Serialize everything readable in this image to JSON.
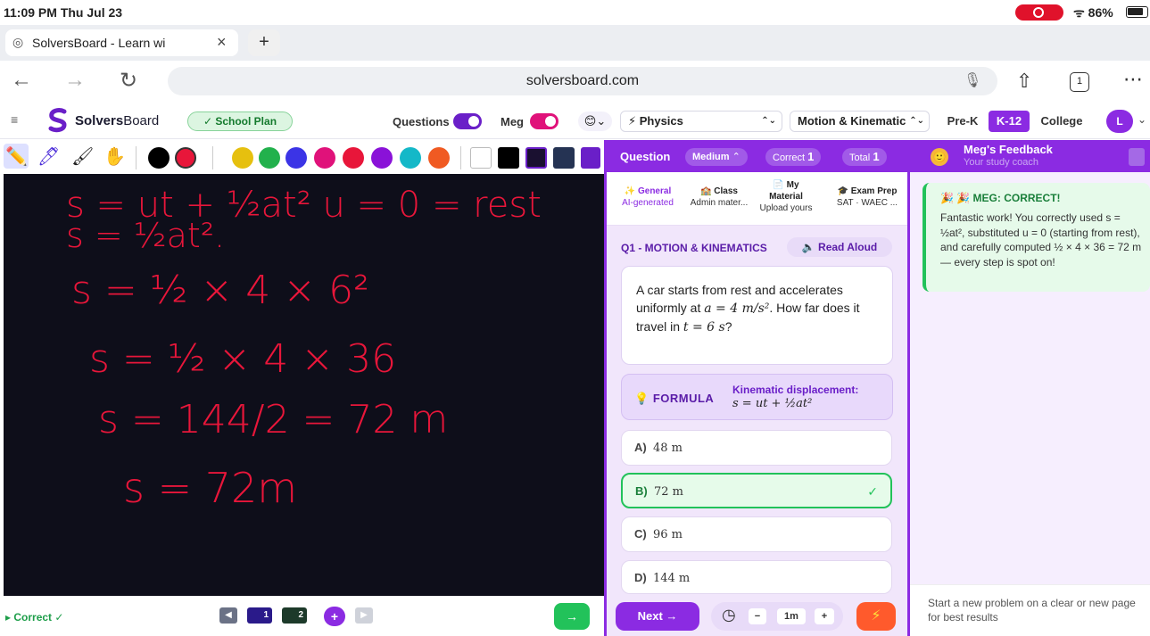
{
  "status": {
    "time": "11:09 PM  Thu Jul 23",
    "battery": "86%"
  },
  "browser": {
    "tab_title": "SolversBoard - Learn wi",
    "url": "solversboard.com",
    "tab_count": "1"
  },
  "header": {
    "brand_bold": "Solvers",
    "brand_light": "Board",
    "plan": "✓ School Plan",
    "questions_label": "Questions",
    "meg_label": "Meg",
    "subject": "⚡ Physics",
    "topic": "Motion & Kinematic",
    "levels": [
      "Pre-K",
      "K-12",
      "College"
    ],
    "avatar": "L"
  },
  "board": {
    "lines": [
      "s = ut + ½at²     u = 0 = rest",
      "s = ½at².",
      "s = ½ × 4 × 6²",
      "s = ½ × 4 × 36",
      "s = 144/2 = 72 m",
      "s = 72m"
    ],
    "status": "Correct ✓",
    "pages": [
      "1",
      "2"
    ]
  },
  "question": {
    "label": "Question",
    "difficulty": "Medium",
    "correct_label": "Correct",
    "correct_value": "1",
    "total_label": "Total",
    "total_value": "1",
    "sources": [
      {
        "title": "General",
        "sub": "AI-generated"
      },
      {
        "title": "Class",
        "sub": "Admin mater..."
      },
      {
        "title": "My Material",
        "sub": "Upload yours"
      },
      {
        "title": "Exam Prep",
        "sub": "SAT · WAEC ..."
      }
    ],
    "title": "Q1 - MOTION & KINEMATICS",
    "read_aloud": "Read Aloud",
    "text_a": "A car starts from rest and accelerates uniformly at",
    "text_b": "a = 4 m/s²",
    "text_c": ". How far does it travel in",
    "text_d": "t = 6 s",
    "text_e": "?",
    "formula_label": "FORMULA",
    "formula_name": "Kinematic displacement:",
    "formula_expr": "s = ut + ½at²",
    "options": [
      {
        "key": "A)",
        "value": "48 m"
      },
      {
        "key": "B)",
        "value": "72 m"
      },
      {
        "key": "C)",
        "value": "96 m"
      },
      {
        "key": "D)",
        "value": "144 m"
      }
    ],
    "next": "Next  →",
    "timer_value": "1m"
  },
  "feedback": {
    "title": "Meg's Feedback",
    "subtitle": "Your study coach",
    "card_title": "🎉 🎉 MEG: CORRECT!",
    "card_body": "Fantastic work! You correctly used s = ½at², substituted u = 0 (starting from rest), and carefully computed ½ × 4 × 36 = 72 m — every step is spot on!",
    "footer": "Start a new problem on a clear or new page for best results"
  },
  "colors": {
    "accent": "#8b2be2",
    "success": "#22c25a",
    "ink": "#e8163a",
    "board": "#0e0e1a"
  }
}
